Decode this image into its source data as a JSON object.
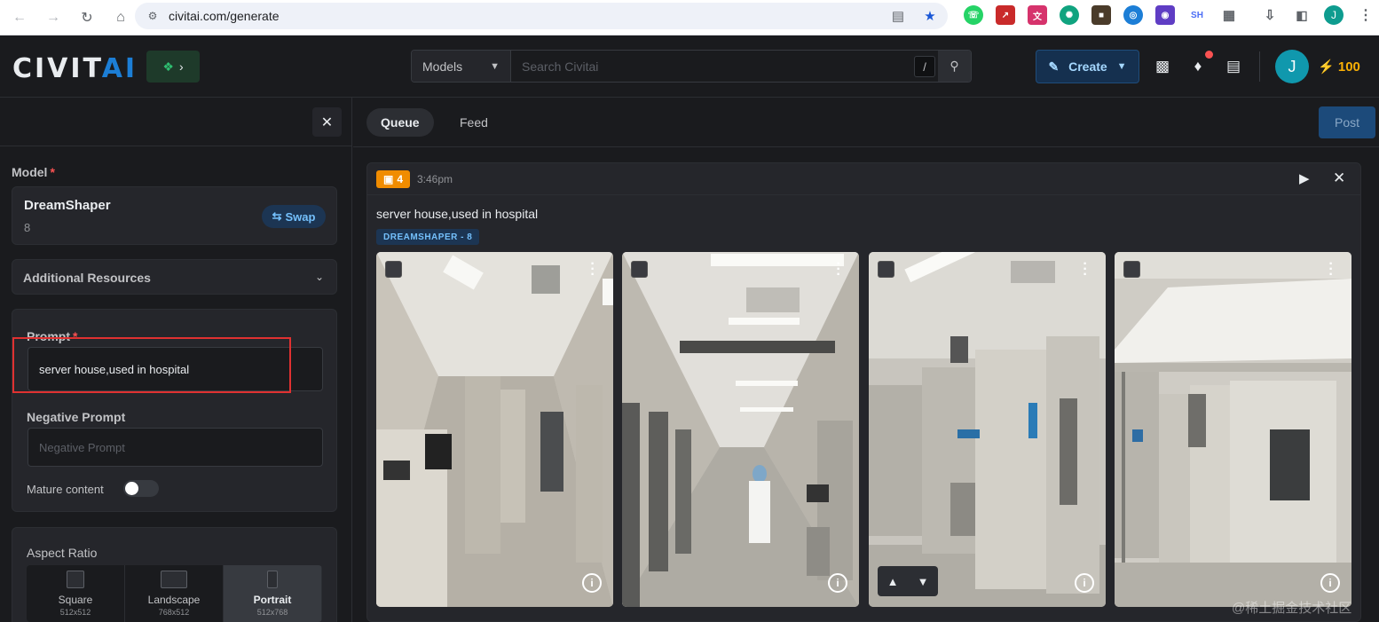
{
  "browser": {
    "url": "civitai.com/generate",
    "profile_initial": "J",
    "extensions": [
      "whatsapp-icon",
      "pdf-icon",
      "translate-icon",
      "chatgpt-icon",
      "dark-ext-icon",
      "globe-ext-icon",
      "shield-ext-icon",
      "sh-ext-icon"
    ],
    "ext_sh_label": "SH"
  },
  "header": {
    "logo_civit": "CIVIT",
    "logo_ai": "AI",
    "search_type": "Models",
    "search_placeholder": "Search Civitai",
    "slash_key": "/",
    "create_label": "Create",
    "avatar_initial": "J",
    "buzz_count": "100"
  },
  "left": {
    "model_label": "Model",
    "model_name": "DreamShaper",
    "model_version": "8",
    "swap_label": "Swap",
    "additional_resources_label": "Additional Resources",
    "prompt_label": "Prompt",
    "prompt_value": "server house,used in hospital",
    "negative_prompt_label": "Negative Prompt",
    "negative_prompt_placeholder": "Negative Prompt",
    "mature_label": "Mature content",
    "mature_enabled": false,
    "aspect_label": "Aspect Ratio",
    "aspect_options": [
      {
        "name": "Square",
        "size": "512x512",
        "active": false
      },
      {
        "name": "Landscape",
        "size": "768x512",
        "active": false
      },
      {
        "name": "Portrait",
        "size": "512x768",
        "active": true
      }
    ]
  },
  "main": {
    "tabs": [
      {
        "label": "Queue",
        "active": true
      },
      {
        "label": "Feed",
        "active": false
      }
    ],
    "post_label": "Post",
    "queue_item": {
      "image_count": "4",
      "time": "3:46pm",
      "prompt": "server house,used in hospital",
      "model_badge": "DREAMSHAPER - 8"
    }
  },
  "watermark": "@稀土掘金技术社区"
}
